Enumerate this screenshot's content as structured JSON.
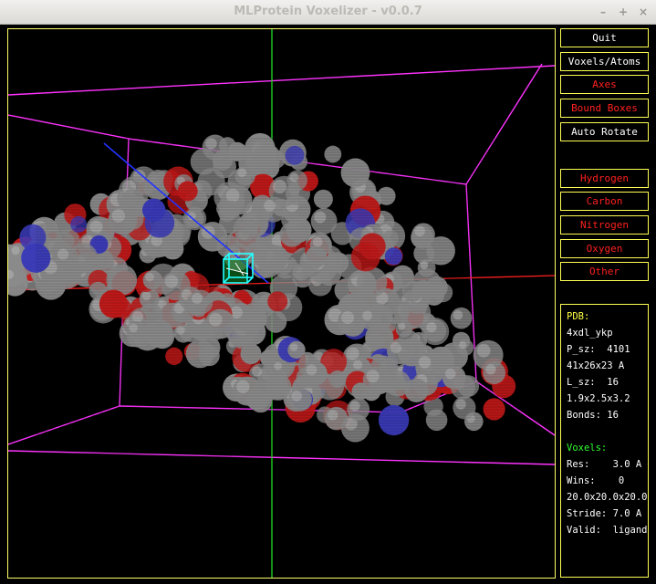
{
  "window": {
    "title": "MLProtein Voxelizer - v0.0.7",
    "controls": [
      "–",
      "+",
      "×"
    ]
  },
  "buttons": {
    "quit": "Quit",
    "voxels_atoms": "Voxels/Atoms",
    "axes": "Axes",
    "bound_boxes": "Bound Boxes",
    "auto_rotate": "Auto Rotate",
    "hydrogen": "Hydrogen",
    "carbon": "Carbon",
    "nitrogen": "Nitrogen",
    "oxygen": "Oxygen",
    "other": "Other"
  },
  "pdb_info": {
    "header": "PDB:",
    "id": "4xdl_ykp",
    "p_sz": "P_sz:  4101",
    "p_dims": "41x26x23 A",
    "l_sz": "L_sz:  16",
    "l_dims": "1.9x2.5x3.2",
    "bonds": "Bonds: 16"
  },
  "voxel_info": {
    "header": "Voxels:",
    "res": "Res:    3.0 A",
    "wins": "Wins:    0",
    "grid": "20.0x20.0x20.0",
    "stride": "Stride: 7.0 A",
    "valid": "Valid:  ligand"
  },
  "colors": {
    "bound_box": "#ff33ff",
    "axis_x": "#ff2020",
    "axis_y": "#22dd22",
    "axis_z": "#2233ff",
    "carbon": "#8a8a8a",
    "oxygen": "#c01818",
    "nitrogen": "#3a3ab8",
    "ligand_box": "#22ffff",
    "button_border": "#ffff55"
  }
}
